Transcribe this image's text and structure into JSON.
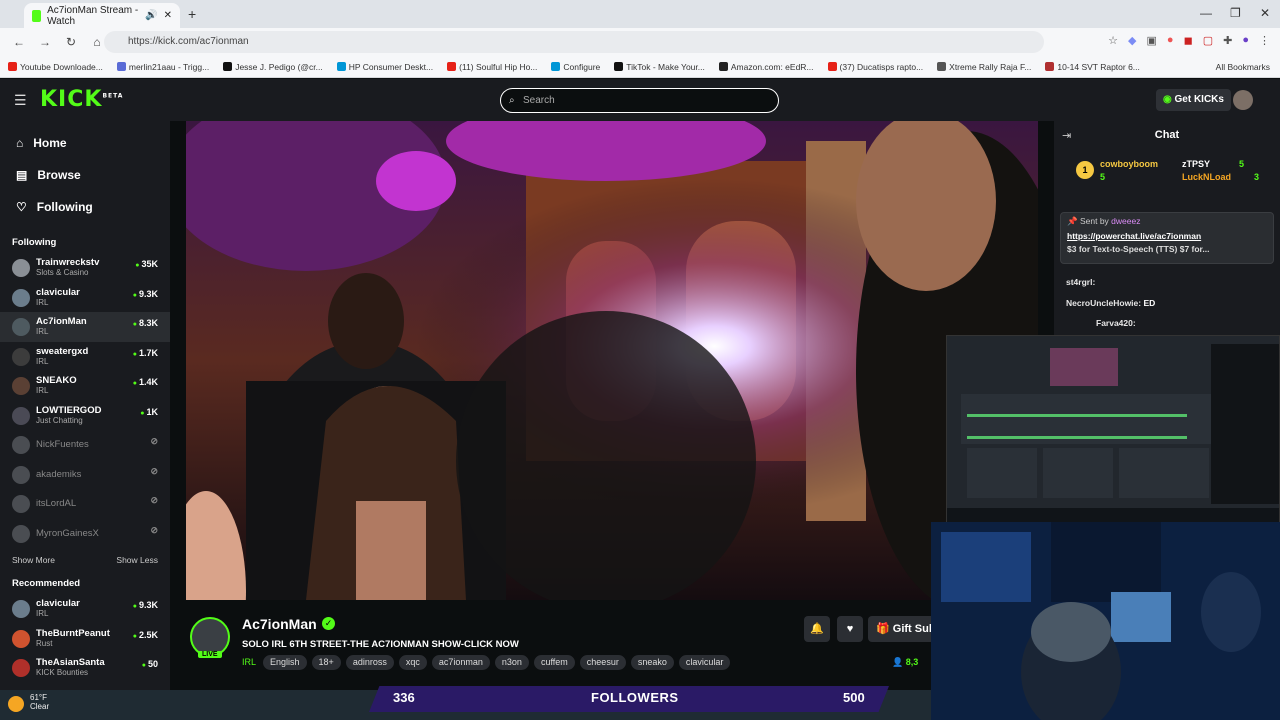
{
  "browser": {
    "tab_title": "Ac7ionMan Stream - Watch",
    "url": "https://kick.com/ac7ionman",
    "bookmarks": [
      {
        "label": "Youtube Downloade...",
        "color": "#e62117"
      },
      {
        "label": "merlin21aau - Trigg...",
        "color": "#5a6bd6"
      },
      {
        "label": "Jesse J. Pedigo (@cr...",
        "color": "#111111"
      },
      {
        "label": "HP Consumer Deskt...",
        "color": "#0096d6"
      },
      {
        "label": "(11) Soulful Hip Ho...",
        "color": "#e62117"
      },
      {
        "label": "Configure",
        "color": "#0096d6"
      },
      {
        "label": "TikTok - Make Your...",
        "color": "#111111"
      },
      {
        "label": "Amazon.com: eEdR...",
        "color": "#222222"
      },
      {
        "label": "(37) Ducatisps rapto...",
        "color": "#e62117"
      },
      {
        "label": "Xtreme Rally Raja F...",
        "color": "#555555"
      },
      {
        "label": "10-14 SVT Raptor 6...",
        "color": "#b03030"
      }
    ],
    "all_bookmarks": "All Bookmarks"
  },
  "header": {
    "logo": "KICK",
    "logo_sup": "BETA",
    "search_placeholder": "Search",
    "get_kicks": "Get KICKs"
  },
  "sidebar": {
    "nav": [
      {
        "label": "Home",
        "icon": "home-icon"
      },
      {
        "label": "Browse",
        "icon": "browse-icon"
      },
      {
        "label": "Following",
        "icon": "heart-icon"
      }
    ],
    "following_title": "Following",
    "following": [
      {
        "name": "Trainwreckstv",
        "category": "Slots & Casino",
        "viewers": "35K",
        "color": "#8a8f95"
      },
      {
        "name": "clavicular",
        "category": "IRL",
        "viewers": "9.3K",
        "color": "#6b7d8c"
      },
      {
        "name": "Ac7ionMan",
        "category": "IRL",
        "viewers": "8.3K",
        "color": "#4e5a60"
      },
      {
        "name": "sweatergxd",
        "category": "IRL",
        "viewers": "1.7K",
        "color": "#3c3c3c"
      },
      {
        "name": "SNEAKO",
        "category": "IRL",
        "viewers": "1.4K",
        "color": "#5a4034"
      },
      {
        "name": "LOWTIERGOD",
        "category": "Just Chatting",
        "viewers": "1K",
        "color": "#4a4a55"
      }
    ],
    "offline": [
      "NickFuentes",
      "akademiks",
      "itsLordAL",
      "MyronGainesX"
    ],
    "show_more": "Show More",
    "show_less": "Show Less",
    "recommended_title": "Recommended",
    "recommended": [
      {
        "name": "clavicular",
        "category": "IRL",
        "viewers": "9.3K",
        "color": "#6b7d8c"
      },
      {
        "name": "TheBurntPeanut",
        "category": "Rust",
        "viewers": "2.5K",
        "color": "#d0532f"
      },
      {
        "name": "TheAsianSanta",
        "category": "KICK Bounties",
        "viewers": "50",
        "color": "#b0302a"
      }
    ]
  },
  "stream": {
    "streamer": "Ac7ionMan",
    "live": "LIVE",
    "title": "SOLO IRL 6TH STREET-THE AC7IONMAN SHOW-CLICK NOW",
    "category": "IRL",
    "tags": [
      "English",
      "18+",
      "adinross",
      "xqc",
      "ac7ionman",
      "n3on",
      "cuffem",
      "cheesur",
      "sneako",
      "clavicular"
    ],
    "gift_subs": "Gift Subs",
    "viewers": "8,3"
  },
  "chat": {
    "title": "Chat",
    "gifters": [
      {
        "name": "cowboyboom",
        "count": "5",
        "color": "#f5c842"
      },
      {
        "name": "zTPSY",
        "count": "5",
        "color": "#ffffff"
      },
      {
        "name": "LuckNLoad",
        "count": "3",
        "color": "#f5a623"
      }
    ],
    "rank_badge": "1",
    "pinned": {
      "sent_by_label": "Sent by",
      "sent_by_user": "dweeez",
      "link": "https://powerchat.live/ac7ionman",
      "text": "$3 for Text-to-Speech (TTS) $7 for..."
    },
    "messages": [
      {
        "user": "st4rgrl:",
        "text": "",
        "color": "#d98cf5"
      },
      {
        "user": "NecroUncleHowie:",
        "text": "ED",
        "color": "#d98cf5"
      },
      {
        "user": "Farva420:",
        "text": "",
        "color": "#d98cf5"
      }
    ]
  },
  "overlay": {
    "followers_count": "336",
    "followers_label": "FOLLOWERS",
    "followers_goal": "500"
  },
  "taskbar": {
    "temp": "61°F",
    "condition": "Clear"
  }
}
